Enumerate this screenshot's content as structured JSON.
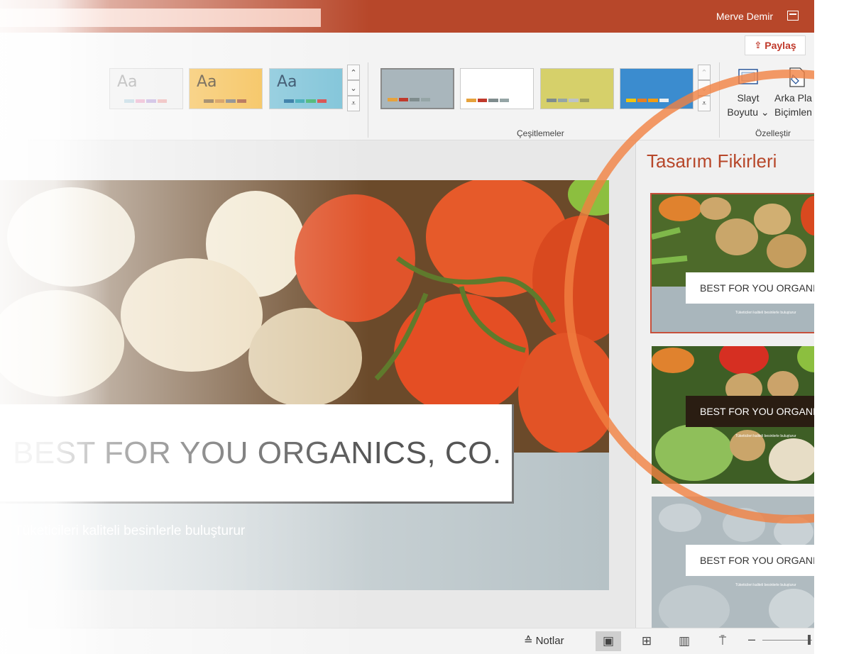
{
  "titlebar": {
    "user_name": "Merve Demir"
  },
  "ribbon": {
    "share_label": "Paylaş",
    "themes": [
      {
        "aa": "Aa",
        "bg": "#ececec",
        "fg": "#8a8a8a",
        "colors": [
          "#a6c9d7",
          "#e59abd",
          "#b39bd5",
          "#e8a0a0"
        ]
      },
      {
        "aa": "Aa",
        "bg": "#f4b942",
        "fg": "#3a2a10",
        "colors": [
          "#7b5a2c",
          "#c97e2b",
          "#6d6d6d",
          "#a34d2a"
        ]
      },
      {
        "aa": "Aa",
        "bg": "#7ec3d8",
        "fg": "#1f3e5a",
        "colors": [
          "#1b6a9a",
          "#2fa3b0",
          "#40b36d",
          "#d64545"
        ]
      }
    ],
    "variants": [
      {
        "bg": "#a9b6bc",
        "colors": [
          "#e6a23c",
          "#c0392b",
          "#7f8c8d",
          "#95a5a6"
        ]
      },
      {
        "bg": "#ffffff",
        "colors": [
          "#e6a23c",
          "#c0392b",
          "#7f8c8d",
          "#95a5a6"
        ]
      },
      {
        "bg": "#d6d06a",
        "colors": [
          "#7f8c8d",
          "#95a5a6",
          "#bdc3c7",
          "#a0a060"
        ]
      },
      {
        "bg": "#3b8ccf",
        "colors": [
          "#f1c40f",
          "#e67e22",
          "#f39c12",
          "#ecf0f1"
        ]
      }
    ],
    "variants_group_label": "Çeşitlemeler",
    "slide_size": {
      "line1": "Slayt",
      "line2": "Boyutu ⌄"
    },
    "format_bg": {
      "line1": "Arka Pla",
      "line2": "Biçimlen"
    },
    "customize_group_label": "Özelleştir"
  },
  "slide": {
    "title": "BEST FOR YOU ORGANICS, CO.",
    "subtitle": "Tüketicileri kaliteli besinlerle buluşturur"
  },
  "design_pane": {
    "title": "Tasarım Fikirleri",
    "ideas": [
      {
        "label": "BEST FOR YOU ORGANIC",
        "tagline": "Tüketicileri kaliteli besinlerle buluşturur"
      },
      {
        "label": "BEST FOR YOU ORGANIC",
        "tagline": "Tüketicileri kaliteli besinlerle buluşturur"
      },
      {
        "label": "BEST FOR YOU ORGANIC",
        "tagline": "Tüketicileri kaliteli besinlerle buluşturur"
      }
    ]
  },
  "statusbar": {
    "notes_label": "Notlar"
  },
  "colors": {
    "accent": "#b7472a",
    "highlight": "#f18141"
  }
}
